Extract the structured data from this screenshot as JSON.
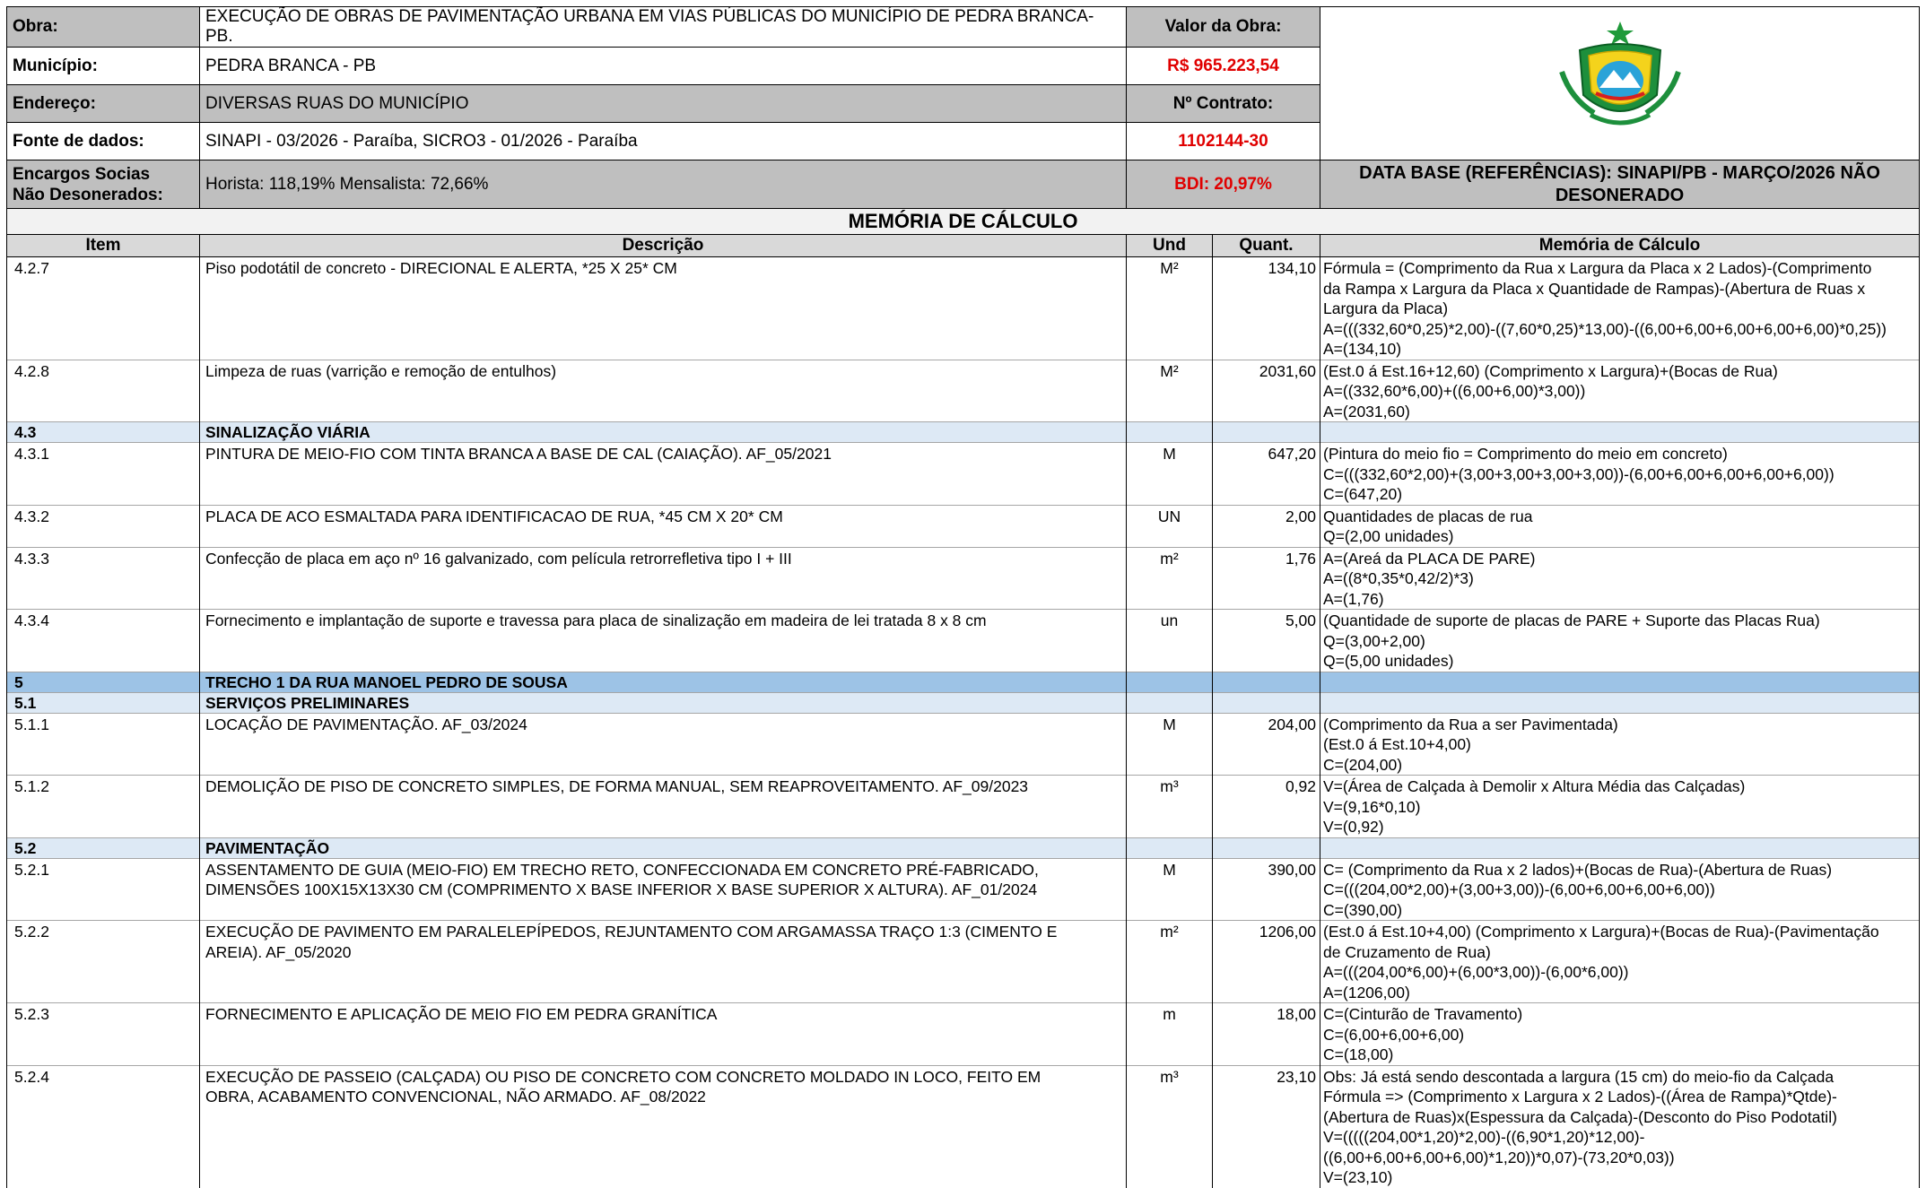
{
  "header": {
    "obra_label": "Obra:",
    "obra_value": "EXECUÇÃO DE OBRAS DE PAVIMENTAÇÃO URBANA EM VIAS PÚBLICAS DO MUNICÍPIO DE PEDRA BRANCA-PB.",
    "valor_label": "Valor da Obra:",
    "valor_value": "R$ 965.223,54",
    "municipio_label": "Município:",
    "municipio_value": "PEDRA BRANCA - PB",
    "contrato_label": "Nº Contrato:",
    "contrato_value": "1102144-30",
    "endereco_label": "Endereço:",
    "endereco_value": " DIVERSAS RUAS DO MUNICÍPIO",
    "fonte_label": "Fonte de dados:",
    "fonte_value": "SINAPI - 03/2026 - Paraíba, SICRO3 - 01/2026 - Paraíba",
    "encargos_label_1": "Encargos Socias",
    "encargos_label_2": "Não Desonerados:",
    "encargos_value": "Horista: 118,19% Mensalista: 72,66%",
    "bdi_value": "BDI:  20,97%",
    "data_base_1": "DATA BASE (REFERÊNCIAS): SINAPI/PB - MARÇO/2026 NÃO",
    "data_base_2": "DESONERADO"
  },
  "title": "MEMÓRIA DE CÁLCULO",
  "columns": {
    "item": "Item",
    "descricao": "Descrição",
    "und": "Und",
    "quant": "Quant.",
    "memoria": "Memória de Cálculo"
  },
  "rows": [
    {
      "type": "item",
      "item": "4.2.7",
      "desc": [
        "Piso podotátil de concreto - DIRECIONAL E ALERTA, *25 X 25* CM"
      ],
      "und": "M²",
      "quant": "134,10",
      "mem": [
        "Fórmula = (Comprimento da Rua x Largura da Placa x 2 Lados)-(Comprimento",
        "da Rampa x Largura da Placa x Quantidade de Rampas)-(Abertura de Ruas x",
        "Largura da Placa)",
        "A=(((332,60*0,25)*2,00)-((7,60*0,25)*13,00)-((6,00+6,00+6,00+6,00+6,00)*0,25))",
        "A=(134,10)"
      ]
    },
    {
      "type": "item",
      "item": "4.2.8",
      "desc": [
        "Limpeza de ruas (varrição e remoção de entulhos)"
      ],
      "und": "M²",
      "quant": "2031,60",
      "mem": [
        "(Est.0 á Est.16+12,60) (Comprimento x Largura)+(Bocas de Rua)",
        "A=((332,60*6,00)+((6,00+6,00)*3,00))",
        "A=(2031,60)"
      ]
    },
    {
      "type": "sec",
      "item": "4.3",
      "desc": [
        "SINALIZAÇÃO VIÁRIA"
      ],
      "und": "",
      "quant": "",
      "mem": []
    },
    {
      "type": "item",
      "item": "4.3.1",
      "desc": [
        "PINTURA DE MEIO-FIO COM TINTA BRANCA A BASE DE CAL (CAIAÇÃO). AF_05/2021"
      ],
      "und": "M",
      "quant": "647,20",
      "mem": [
        "(Pintura do meio fio = Comprimento do meio em concreto)",
        "C=(((332,60*2,00)+(3,00+3,00+3,00+3,00))-(6,00+6,00+6,00+6,00+6,00))",
        "C=(647,20)"
      ]
    },
    {
      "type": "item",
      "item": "4.3.2",
      "desc": [
        "PLACA DE ACO ESMALTADA PARA  IDENTIFICACAO DE RUA, *45 CM X 20* CM"
      ],
      "und": "UN",
      "quant": "2,00",
      "mem": [
        "Quantidades de placas de rua",
        "Q=(2,00 unidades)"
      ]
    },
    {
      "type": "item",
      "item": "4.3.3",
      "desc": [
        "Confecção de placa em aço nº 16 galvanizado, com película retrorrefletiva tipo I + III"
      ],
      "und": "m²",
      "quant": "1,76",
      "mem": [
        "A=(Areá da PLACA DE PARE)",
        "A=((8*0,35*0,42/2)*3)",
        "A=(1,76)"
      ]
    },
    {
      "type": "item",
      "item": "4.3.4",
      "desc": [
        "Fornecimento e implantação de suporte e travessa para placa de sinalização em madeira de lei tratada 8 x 8 cm"
      ],
      "und": "un",
      "quant": "5,00",
      "mem": [
        "(Quantidade de suporte de placas de PARE + Suporte das Placas Rua)",
        "Q=(3,00+2,00)",
        "Q=(5,00 unidades)"
      ]
    },
    {
      "type": "sec-main",
      "item": "5",
      "desc": [
        "TRECHO 1 DA RUA MANOEL PEDRO DE SOUSA"
      ],
      "und": "",
      "quant": "",
      "mem": []
    },
    {
      "type": "sec",
      "item": "5.1",
      "desc": [
        "SERVIÇOS PRELIMINARES"
      ],
      "und": "",
      "quant": "",
      "mem": []
    },
    {
      "type": "item",
      "item": "5.1.1",
      "desc": [
        "LOCAÇÃO DE PAVIMENTAÇÃO. AF_03/2024"
      ],
      "und": "M",
      "quant": "204,00",
      "mem": [
        "(Comprimento da Rua a ser Pavimentada)",
        "(Est.0 á Est.10+4,00)",
        "C=(204,00)"
      ]
    },
    {
      "type": "item",
      "item": "5.1.2",
      "desc": [
        "DEMOLIÇÃO DE PISO DE CONCRETO SIMPLES, DE FORMA MANUAL, SEM REAPROVEITAMENTO. AF_09/2023"
      ],
      "und": "m³",
      "quant": "0,92",
      "mem": [
        "V=(Área de Calçada à Demolir x Altura Média das Calçadas)",
        "V=(9,16*0,10)",
        "V=(0,92)"
      ]
    },
    {
      "type": "sec",
      "item": "5.2",
      "desc": [
        "PAVIMENTAÇÃO"
      ],
      "und": "",
      "quant": "",
      "mem": []
    },
    {
      "type": "item",
      "item": "5.2.1",
      "desc": [
        "ASSENTAMENTO DE GUIA (MEIO-FIO) EM TRECHO RETO, CONFECCIONADA EM CONCRETO PRÉ-FABRICADO,",
        "DIMENSÕES 100X15X13X30 CM (COMPRIMENTO X BASE INFERIOR X BASE SUPERIOR X ALTURA). AF_01/2024"
      ],
      "und": "M",
      "quant": "390,00",
      "mem": [
        "C= (Comprimento da Rua x 2 lados)+(Bocas de Rua)-(Abertura de Ruas)",
        "C=(((204,00*2,00)+(3,00+3,00))-(6,00+6,00+6,00+6,00))",
        "C=(390,00)"
      ]
    },
    {
      "type": "item",
      "item": "5.2.2",
      "desc": [
        "EXECUÇÃO DE PAVIMENTO EM PARALELEPÍPEDOS, REJUNTAMENTO COM ARGAMASSA TRAÇO 1:3 (CIMENTO E",
        "AREIA). AF_05/2020"
      ],
      "und": "m²",
      "quant": "1206,00",
      "mem": [
        "(Est.0 á Est.10+4,00) (Comprimento x Largura)+(Bocas de Rua)-(Pavimentação",
        "de Cruzamento de Rua)",
        "A=(((204,00*6,00)+(6,00*3,00))-(6,00*6,00))",
        "A=(1206,00)"
      ]
    },
    {
      "type": "item",
      "item": "5.2.3",
      "desc": [
        "FORNECIMENTO E APLICAÇÃO DE MEIO FIO EM PEDRA GRANÍTICA"
      ],
      "und": "m",
      "quant": "18,00",
      "mem": [
        "C=(Cinturão de Travamento)",
        "C=(6,00+6,00+6,00)",
        "C=(18,00)"
      ]
    },
    {
      "type": "item",
      "item": "5.2.4",
      "desc": [
        "EXECUÇÃO DE PASSEIO (CALÇADA) OU PISO DE CONCRETO COM CONCRETO MOLDADO IN LOCO, FEITO EM",
        "OBRA, ACABAMENTO CONVENCIONAL, NÃO ARMADO. AF_08/2022"
      ],
      "und": "m³",
      "quant": "23,10",
      "mem": [
        "Obs: Já está sendo descontada a largura (15 cm) do meio-fio da Calçada",
        "Fórmula => (Comprimento x Largura x 2 Lados)-((Área de Rampa)*Qtde)-",
        "(Abertura de Ruas)x(Espessura da Calçada)-(Desconto do Piso Podotatil)",
        "V=(((((204,00*1,20)*2,00)-((6,90*1,20)*12,00)-",
        "((6,00+6,00+6,00+6,00)*1,20))*0,07)-(73,20*0,03))",
        "V=(23,10)"
      ]
    }
  ]
}
